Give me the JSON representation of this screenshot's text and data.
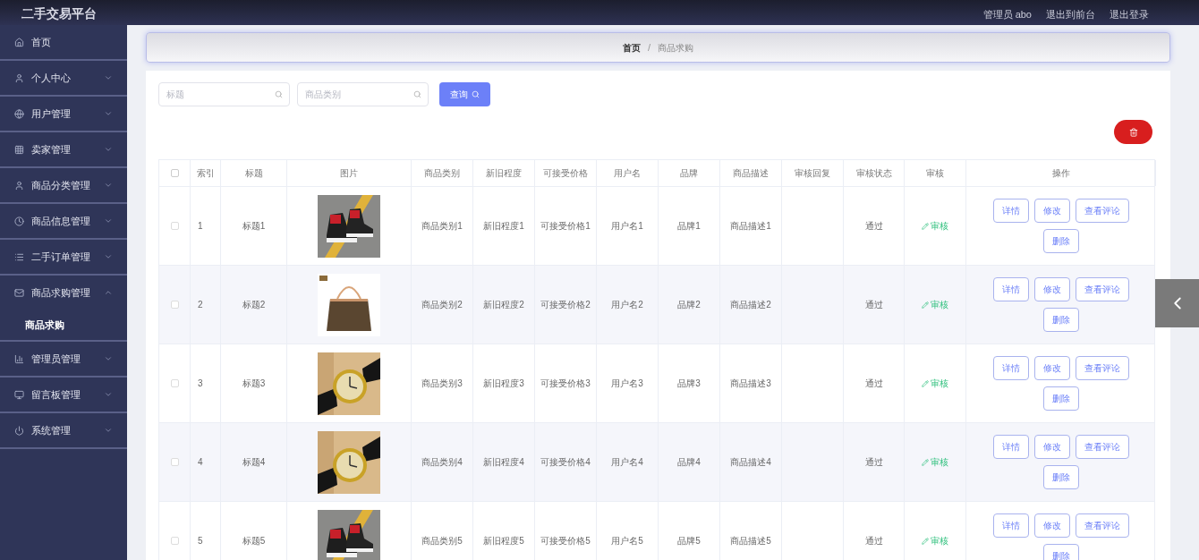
{
  "header": {
    "title": "二手交易平台",
    "links": [
      "管理员 abo",
      "退出到前台",
      "退出登录"
    ]
  },
  "sidebar": {
    "items": [
      {
        "label": "首页"
      },
      {
        "label": "个人中心",
        "expanded": false
      },
      {
        "label": "用户管理",
        "expanded": false
      },
      {
        "label": "卖家管理",
        "expanded": false
      },
      {
        "label": "商品分类管理",
        "expanded": false
      },
      {
        "label": "商品信息管理",
        "expanded": false
      },
      {
        "label": "二手订单管理",
        "expanded": false
      },
      {
        "label": "商品求购管理",
        "expanded": true,
        "children": [
          {
            "label": "商品求购"
          }
        ]
      },
      {
        "label": "管理员管理",
        "expanded": false
      },
      {
        "label": "留言板管理",
        "expanded": false
      },
      {
        "label": "系统管理",
        "expanded": false
      }
    ]
  },
  "breadcrumb": {
    "items": [
      "首页",
      "商品求购"
    ],
    "separator": "/"
  },
  "search": {
    "fields": [
      {
        "placeholder": "标题"
      },
      {
        "placeholder": "商品类别"
      }
    ],
    "button": "查询"
  },
  "table": {
    "select_all": {
      "checked": false
    },
    "columns": [
      "索引",
      "标题",
      "图片",
      "商品类别",
      "新旧程度",
      "可接受价格",
      "用户名",
      "品牌",
      "商品描述",
      "审核回复",
      "审核状态",
      "审核",
      "操作"
    ],
    "rows": [
      {
        "checked": false,
        "cells": [
          "1",
          "标题1",
          {
            "kind": "picture"
          },
          "商品类别1",
          "新旧程度1",
          "可接受价格1",
          "用户名1",
          "品牌1",
          "商品描述1",
          "",
          "通过"
        ],
        "audit": "审核",
        "actions": [
          "详情",
          "修改",
          "查看评论",
          "删除"
        ]
      },
      {
        "checked": false,
        "cells": [
          "2",
          "标题2",
          {
            "kind": "picture"
          },
          "商品类别2",
          "新旧程度2",
          "可接受价格2",
          "用户名2",
          "品牌2",
          "商品描述2",
          "",
          "通过"
        ],
        "audit": "审核",
        "actions": [
          "详情",
          "修改",
          "查看评论",
          "删除"
        ]
      },
      {
        "checked": false,
        "cells": [
          "3",
          "标题3",
          {
            "kind": "picture"
          },
          "商品类别3",
          "新旧程度3",
          "可接受价格3",
          "用户名3",
          "品牌3",
          "商品描述3",
          "",
          "通过"
        ],
        "audit": "审核",
        "actions": [
          "详情",
          "修改",
          "查看评论",
          "删除"
        ]
      },
      {
        "checked": false,
        "cells": [
          "4",
          "标题4",
          {
            "kind": "picture"
          },
          "商品类别4",
          "新旧程度4",
          "可接受价格4",
          "用户名4",
          "品牌4",
          "商品描述4",
          "",
          "通过"
        ],
        "audit": "审核",
        "actions": [
          "详情",
          "修改",
          "查看评论",
          "删除"
        ]
      },
      {
        "checked": false,
        "cells": [
          "5",
          "标题5",
          {
            "kind": "picture"
          },
          "商品类别5",
          "新旧程度5",
          "可接受价格5",
          "用户名5",
          "品牌5",
          "商品描述5",
          "",
          "通过"
        ],
        "audit": "审核",
        "actions": [
          "详情",
          "修改",
          "查看评论",
          "删除"
        ]
      }
    ]
  }
}
